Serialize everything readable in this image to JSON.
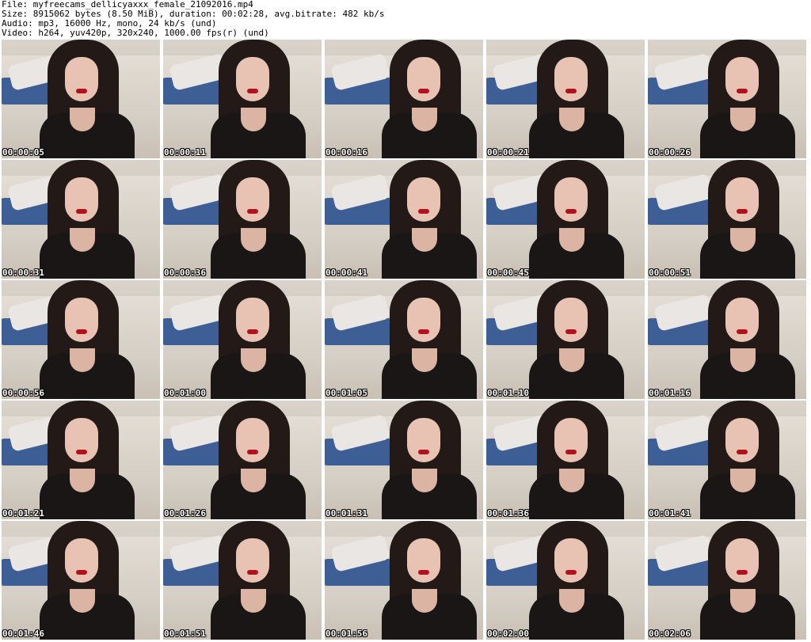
{
  "header": {
    "file": "File: myfreecams_dellicyaxxx_female_21092016.mp4",
    "size": "Size: 8915062 bytes (8.50 MiB), duration: 00:02:28, avg.bitrate: 482 kb/s",
    "audio": "Audio: mp3, 16000 Hz, mono, 24 kb/s (und)",
    "video": "Video: h264, yuv420p, 320x240, 1000.00 fps(r) (und)"
  },
  "thumbnails": [
    {
      "time": "00:00:05"
    },
    {
      "time": "00:00:11"
    },
    {
      "time": "00:00:16"
    },
    {
      "time": "00:00:21"
    },
    {
      "time": "00:00:26"
    },
    {
      "time": "00:00:31"
    },
    {
      "time": "00:00:36"
    },
    {
      "time": "00:00:41"
    },
    {
      "time": "00:00:45"
    },
    {
      "time": "00:00:51"
    },
    {
      "time": "00:00:56"
    },
    {
      "time": "00:01:00"
    },
    {
      "time": "00:01:05"
    },
    {
      "time": "00:01:10"
    },
    {
      "time": "00:01:16"
    },
    {
      "time": "00:01:21"
    },
    {
      "time": "00:01:26"
    },
    {
      "time": "00:01:31"
    },
    {
      "time": "00:01:36"
    },
    {
      "time": "00:01:41"
    },
    {
      "time": "00:01:46"
    },
    {
      "time": "00:01:51"
    },
    {
      "time": "00:01:56"
    },
    {
      "time": "00:02:00"
    },
    {
      "time": "00:02:06"
    }
  ]
}
